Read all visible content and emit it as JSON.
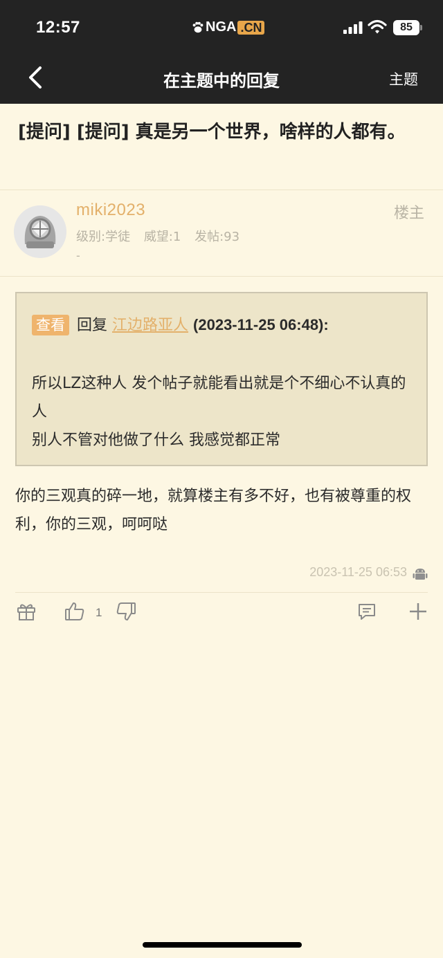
{
  "status_bar": {
    "time": "12:57",
    "battery": "85"
  },
  "brand": {
    "nga": "NGA",
    "cn": ".CN"
  },
  "nav": {
    "title": "在主题中的回复",
    "right_label": "主题"
  },
  "topic": {
    "title": "[提问] [提问] 真是另一个世界，啥样的人都有。"
  },
  "author": {
    "username": "miki2023",
    "level": "级别:学徒",
    "prestige": "威望:1",
    "posts": "发帖:93",
    "signature": "-",
    "floor_label": "楼主"
  },
  "quote": {
    "badge": "查看",
    "reply_prefix": "回复",
    "quoted_user": "江边路亚人",
    "quoted_time": "(2023-11-25 06:48):",
    "lines": [
      "所以LZ这种人 发个帖子就能看出就是个不细心不认真的人",
      "别人不管对他做了什么 我感觉都正常"
    ]
  },
  "reply": {
    "text": "你的三观真的碎一地，就算楼主有多不好，也有被尊重的权利，你的三观，呵呵哒"
  },
  "post": {
    "timestamp": "2023-11-25 06:53",
    "device_icon": "android-icon"
  },
  "actions": {
    "like_count": "1"
  },
  "colors": {
    "accent": "#e3b06a",
    "background": "#fdf7e3",
    "header": "#232323",
    "quote_bg": "#ede5c9"
  }
}
